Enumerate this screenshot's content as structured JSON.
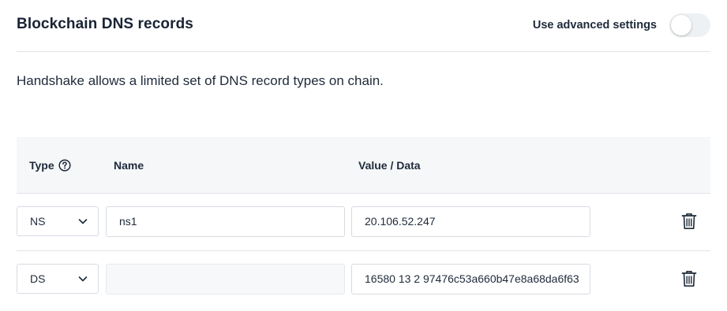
{
  "header": {
    "title": "Blockchain DNS records",
    "advanced_label": "Use advanced settings",
    "advanced_enabled": false
  },
  "description": "Handshake allows a limited set of DNS record types on chain.",
  "table": {
    "columns": {
      "type": "Type",
      "name": "Name",
      "value": "Value / Data"
    },
    "rows": [
      {
        "type": "NS",
        "name": "ns1",
        "value": "20.106.52.247",
        "name_disabled": false
      },
      {
        "type": "DS",
        "name": "",
        "value": "16580 13 2 97476c53a660b47e8a68da6f63",
        "name_disabled": true
      }
    ]
  },
  "icons": {
    "help": "question-circle-icon",
    "dropdown": "chevron-down-icon",
    "delete": "trash-icon"
  }
}
